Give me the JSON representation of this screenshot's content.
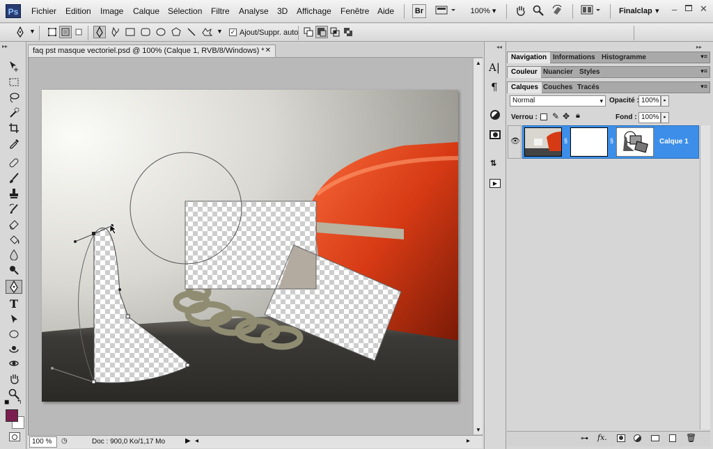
{
  "app": {
    "logo": "Ps",
    "accent": "#3c8ee8"
  },
  "menubar": {
    "items": [
      "Fichier",
      "Edition",
      "Image",
      "Calque",
      "Sélection",
      "Filtre",
      "Analyse",
      "3D",
      "Affichage",
      "Fenêtre",
      "Aide"
    ],
    "bridge": "Br",
    "zoom": "100%",
    "workspace": "Finalclap",
    "icons": [
      "bridge-icon",
      "mini-bridge-icon",
      "hand-icon",
      "zoom-icon",
      "rotate-view-icon",
      "arrange-icon"
    ]
  },
  "optionsbar": {
    "auto_add_delete": "Ajout/Suppr. auto",
    "auto_add_delete_checked": true
  },
  "document": {
    "tab_title": "faq pst masque vectoriel.psd @ 100% (Calque 1, RVB/8/Windows) *",
    "zoom": "100 %",
    "doc_info": "Doc : 900,0 Ko/1,17 Mo"
  },
  "panels": {
    "group1_tabs": [
      "Navigation",
      "Informations",
      "Histogramme"
    ],
    "group2_tabs": [
      "Couleur",
      "Nuancier",
      "Styles"
    ],
    "group3_tabs": [
      "Calques",
      "Couches",
      "Tracés"
    ],
    "blend_mode": "Normal",
    "opacity_label": "Opacité :",
    "opacity_value": "100%",
    "lock_label": "Verrou :",
    "fill_label": "Fond :",
    "fill_value": "100%",
    "layer_name": "Calque 1",
    "bottom_icons": [
      "link-icon",
      "fx-icon",
      "add-mask-icon",
      "adjustment-icon",
      "group-icon",
      "new-layer-icon",
      "trash-icon"
    ]
  },
  "colors": {
    "foreground": "#7a1e4f",
    "background": "#ffffff"
  }
}
